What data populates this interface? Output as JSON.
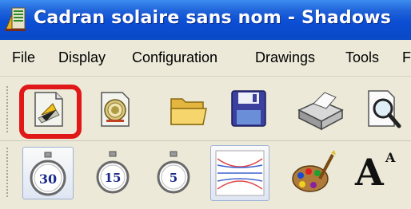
{
  "window": {
    "title": "Cadran solaire sans nom - Shadows"
  },
  "menu": {
    "items": [
      "File",
      "Display",
      "Configuration",
      "Drawings",
      "Tools",
      "F"
    ]
  },
  "toolbar1": {
    "buttons": [
      {
        "icon": "new-sundial-icon",
        "highlighted": true
      },
      {
        "icon": "dial-document-icon"
      },
      {
        "icon": "open-folder-icon"
      },
      {
        "icon": "save-floppy-icon"
      },
      {
        "icon": "printer-icon"
      },
      {
        "icon": "print-preview-icon"
      }
    ]
  },
  "toolbar2": {
    "stopwatch_labels": [
      "30",
      "15",
      "5"
    ],
    "text_button_label": "A",
    "text_button_superscript": "A"
  },
  "colors": {
    "titlebar": "#0b4ed4",
    "highlight": "#e01818",
    "toolbar_bg": "#ece9d8"
  }
}
